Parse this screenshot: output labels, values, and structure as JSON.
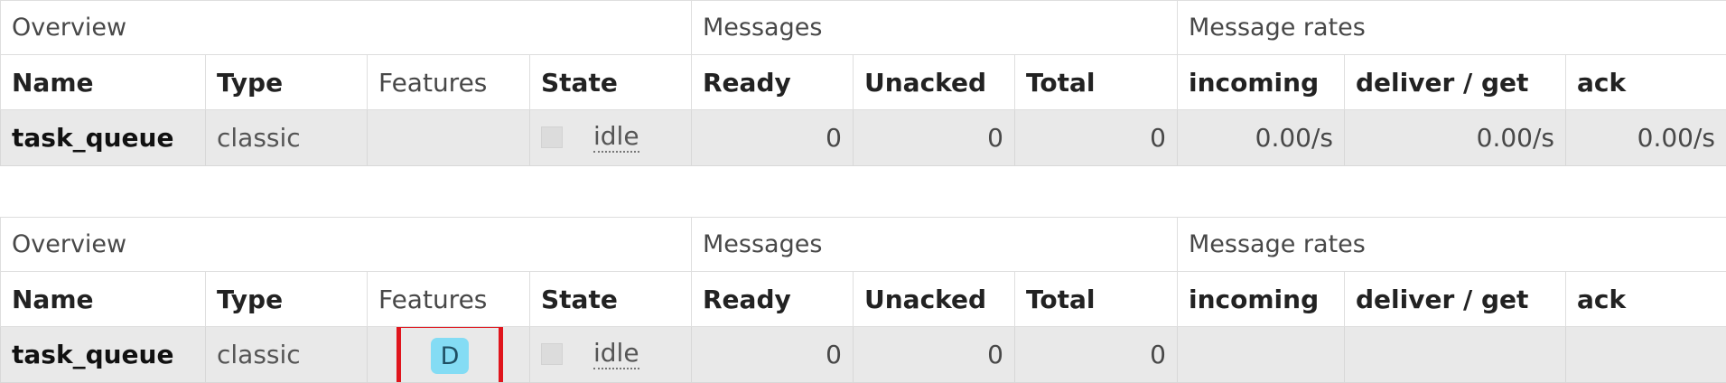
{
  "groups": {
    "overview": "Overview",
    "messages": "Messages",
    "message_rates": "Message rates"
  },
  "columns": {
    "name": "Name",
    "type": "Type",
    "features": "Features",
    "state": "State",
    "ready": "Ready",
    "unacked": "Unacked",
    "total": "Total",
    "incoming": "incoming",
    "deliver_get": "deliver / get",
    "ack": "ack"
  },
  "tables": [
    {
      "row": {
        "name": "task_queue",
        "type": "classic",
        "features": "",
        "state": "idle",
        "ready": "0",
        "unacked": "0",
        "total": "0",
        "incoming": "0.00/s",
        "deliver_get": "0.00/s",
        "ack": "0.00/s"
      }
    },
    {
      "row": {
        "name": "task_queue",
        "type": "classic",
        "features": "D",
        "state": "idle",
        "ready": "0",
        "unacked": "0",
        "total": "0",
        "incoming": "",
        "deliver_get": "",
        "ack": ""
      },
      "features_highlight_color": "#e0151d",
      "badge_color": "#84dcf4"
    }
  ]
}
